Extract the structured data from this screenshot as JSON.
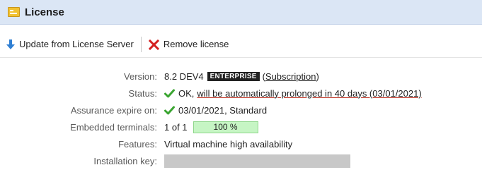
{
  "header": {
    "title": "License"
  },
  "toolbar": {
    "update_label": "Update from License Server",
    "remove_label": "Remove license"
  },
  "details": {
    "version": {
      "label": "Version:",
      "value": "8.2 DEV4",
      "edition": "ENTERPRISE",
      "open_paren": "(",
      "subscription": "Subscription",
      "close_paren": ")"
    },
    "status": {
      "label": "Status:",
      "ok": "OK,",
      "prolong": "will be automatically prolonged in 40 days (03/01/2021)"
    },
    "assurance": {
      "label": "Assurance expire on:",
      "value": "03/01/2021, Standard"
    },
    "terminals": {
      "label": "Embedded terminals:",
      "count": "1 of 1",
      "percent_text": "100 %",
      "progress": 1.0
    },
    "features": {
      "label": "Features:",
      "value": "Virtual machine high availability"
    },
    "installation_key": {
      "label": "Installation key:"
    }
  },
  "colors": {
    "accent_header": "#dbe6f5",
    "check_green": "#3aa531",
    "remove_red": "#d42020",
    "progress_green": "#c6f5c4"
  }
}
